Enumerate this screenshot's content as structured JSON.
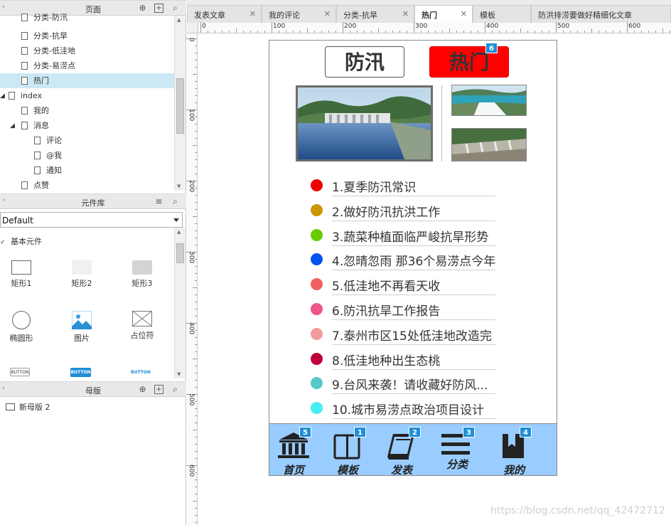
{
  "panels": {
    "pages": {
      "title": "页面",
      "items": [
        {
          "label": "分类-防汛",
          "indent": 30
        },
        {
          "label": "分类-抗旱",
          "indent": 30
        },
        {
          "label": "分类-低洼地",
          "indent": 30
        },
        {
          "label": "分类-易涝点",
          "indent": 30
        },
        {
          "label": "热门",
          "indent": 30,
          "selected": true
        },
        {
          "label": "index",
          "indent": 12
        },
        {
          "label": "我的",
          "indent": 30
        },
        {
          "label": "消息",
          "indent": 30
        },
        {
          "label": "评论",
          "indent": 48
        },
        {
          "label": "@我",
          "indent": 48
        },
        {
          "label": "通知",
          "indent": 48
        },
        {
          "label": "点赞",
          "indent": 30
        }
      ]
    },
    "library": {
      "title": "元件库",
      "select_value": "Default",
      "group_label": "基本元件",
      "widgets": [
        "矩形1",
        "矩形2",
        "矩形3",
        "椭圆形",
        "图片",
        "占位符"
      ],
      "button_labels": [
        "BUTTON",
        "BUTTON",
        "BUTTON"
      ]
    },
    "masters": {
      "title": "母版",
      "items": [
        "新母版 2"
      ]
    }
  },
  "tabs": [
    {
      "label": "发表文章",
      "active": false
    },
    {
      "label": "我的评论",
      "active": false
    },
    {
      "label": "分类-抗旱",
      "active": false
    },
    {
      "label": "热门",
      "active": true
    },
    {
      "label": "模板",
      "active": false
    },
    {
      "label": "防洪排涝要做好精细化文章",
      "active": false
    }
  ],
  "ruler": {
    "h_labels": [
      "0",
      "100",
      "200",
      "300",
      "400",
      "500",
      "600"
    ],
    "v_labels": [
      "0",
      "100",
      "200",
      "300",
      "400",
      "500",
      "600"
    ]
  },
  "phone": {
    "top_buttons": {
      "left": {
        "label": "防汛"
      },
      "right": {
        "label": "热门",
        "badge": "6"
      }
    },
    "news": [
      {
        "text": "1.夏季防汛常识",
        "color": "#ee0000"
      },
      {
        "text": "2.做好防汛抗洪工作",
        "color": "#c89600"
      },
      {
        "text": "3.蔬菜种植面临严峻抗旱形势",
        "color": "#66cc00"
      },
      {
        "text": "4.忽晴忽雨 那36个易涝点今年",
        "color": "#0055ee"
      },
      {
        "text": "5.低洼地不再看天收",
        "color": "#f06060"
      },
      {
        "text": "6.防汛抗旱工作报告",
        "color": "#ee5588"
      },
      {
        "text": "7.泰州市区15处低洼地改造完",
        "color": "#f09a9a"
      },
      {
        "text": "8.低洼地种出生态桃",
        "color": "#c0003a"
      },
      {
        "text": "9.台风来袭！请收藏好防风...",
        "color": "#55c8c8"
      },
      {
        "text": "10.城市易涝点政治项目设计",
        "color": "#44eeee"
      }
    ],
    "tabbar": [
      {
        "label": "首页",
        "badge": "5",
        "icon": "bank-icon"
      },
      {
        "label": "模板",
        "badge": "1",
        "icon": "book-open-icon"
      },
      {
        "label": "发表",
        "badge": "2",
        "icon": "notebook-icon"
      },
      {
        "label": "分类",
        "badge": "3",
        "icon": "menu-icon"
      },
      {
        "label": "我的",
        "badge": "4",
        "icon": "bookmark-icon"
      }
    ]
  },
  "watermark": "https://blog.csdn.net/qq_42472712",
  "colors": {
    "accent": "#1e8fd6",
    "tabbar_bg": "#99ccff",
    "hot_button": "#ff0000",
    "selected_row": "#cde8f5"
  }
}
